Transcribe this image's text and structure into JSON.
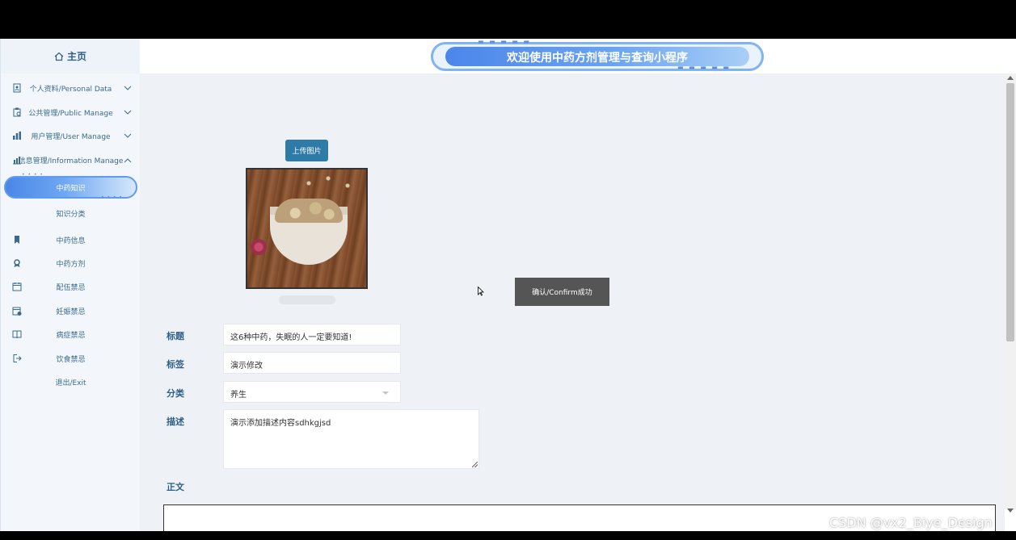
{
  "header": {
    "banner_title": "欢迎使用中药方剂管理与查询小程序"
  },
  "sidebar": {
    "home_label": "主页",
    "items": [
      {
        "label": "个人资料/Personal Data",
        "icon": "profile-icon",
        "expandable": true
      },
      {
        "label": "公共管理/Public Manage",
        "icon": "clipboard-icon",
        "expandable": true
      },
      {
        "label": "用户管理/User Manage",
        "icon": "users-icon",
        "expandable": true
      },
      {
        "label": "信息管理/Information Manage",
        "icon": "chart-icon",
        "expandable": true,
        "expanded": true
      },
      {
        "label": "中药知识",
        "active": true
      },
      {
        "label": "知识分类"
      },
      {
        "label": "中药信息",
        "icon": "bookmark-icon"
      },
      {
        "label": "中药方剂",
        "icon": "award-icon"
      },
      {
        "label": "配伍禁忌",
        "icon": "calendar-icon"
      },
      {
        "label": "妊娠禁忌",
        "icon": "calendar-check-icon"
      },
      {
        "label": "病症禁忌",
        "icon": "book-icon"
      },
      {
        "label": "饮食禁忌",
        "icon": "logout-icon"
      },
      {
        "label": "退出/Exit"
      }
    ]
  },
  "form": {
    "upload_label": "上传图片",
    "title_label": "标题",
    "title_value": "这6种中药，失眠的人一定要知道!",
    "tag_label": "标签",
    "tag_value": "演示修改",
    "category_label": "分类",
    "category_value": "养生",
    "desc_label": "描述",
    "desc_value": "演示添加描述内容sdhkgjsd",
    "body_label": "正文"
  },
  "toast": {
    "message": "确认/Confirm成功"
  },
  "watermark": "CSDN @vx2_Biye_Design",
  "colors": {
    "accent": "#2f7ba8",
    "label": "#2d5f86",
    "banner": "#4c86ea"
  }
}
